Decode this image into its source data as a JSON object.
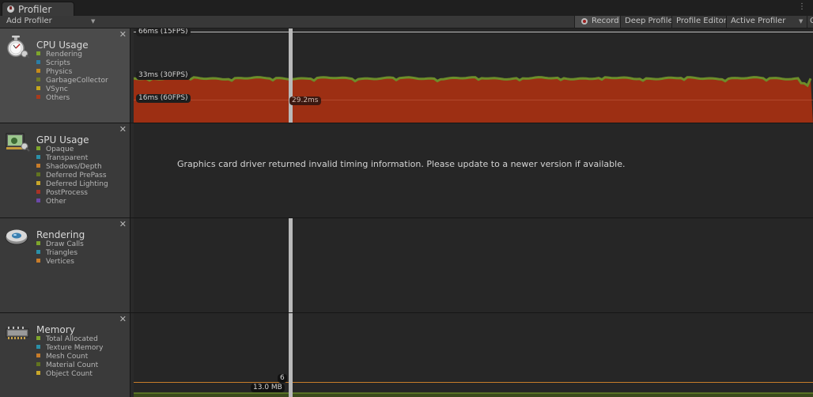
{
  "window": {
    "tab_title": "Profiler",
    "menu_glyph": "⋮"
  },
  "toolbar": {
    "add_profiler": "Add Profiler",
    "record": "Record",
    "deep_profile": "Deep Profile",
    "profile_editor": "Profile Editor",
    "active_profiler": "Active Profiler",
    "clear_cut": "C",
    "record_active": true
  },
  "panels": {
    "cpu": {
      "title": "CPU Usage",
      "selected": true,
      "items": [
        {
          "label": "Rendering",
          "color": "#7ea52c"
        },
        {
          "label": "Scripts",
          "color": "#2b7ea6"
        },
        {
          "label": "Physics",
          "color": "#c78b1a"
        },
        {
          "label": "GarbageCollector",
          "color": "#6f7a27"
        },
        {
          "label": "VSync",
          "color": "#c5a71c"
        },
        {
          "label": "Others",
          "color": "#a83a1c"
        }
      ],
      "graph": {
        "label_66": "66ms (15FPS)",
        "label_33": "33ms (30FPS)",
        "label_16": "16ms (60FPS)",
        "cursor_value": "29.2ms"
      }
    },
    "gpu": {
      "title": "GPU Usage",
      "items": [
        {
          "label": "Opaque",
          "color": "#7ea52c"
        },
        {
          "label": "Transparent",
          "color": "#2b90a8"
        },
        {
          "label": "Shadows/Depth",
          "color": "#c87c2a"
        },
        {
          "label": "Deferred PrePass",
          "color": "#62741f"
        },
        {
          "label": "Deferred Lighting",
          "color": "#c8a72a"
        },
        {
          "label": "PostProcess",
          "color": "#a83226"
        },
        {
          "label": "Other",
          "color": "#6b48a8"
        }
      ],
      "message": "Graphics card driver returned invalid timing information. Please update to a newer version if available."
    },
    "rendering": {
      "title": "Rendering",
      "items": [
        {
          "label": "Draw Calls",
          "color": "#7ea52c"
        },
        {
          "label": "Triangles",
          "color": "#2b90a8"
        },
        {
          "label": "Vertices",
          "color": "#c87c2a"
        }
      ]
    },
    "memory": {
      "title": "Memory",
      "items": [
        {
          "label": "Total Allocated",
          "color": "#7ea52c"
        },
        {
          "label": "Texture Memory",
          "color": "#2b90a8"
        },
        {
          "label": "Mesh Count",
          "color": "#c87c2a"
        },
        {
          "label": "Material Count",
          "color": "#62741f"
        },
        {
          "label": "Object Count",
          "color": "#c8a72a"
        }
      ],
      "value_count": "6",
      "value_mem": "13.0 MB"
    }
  }
}
